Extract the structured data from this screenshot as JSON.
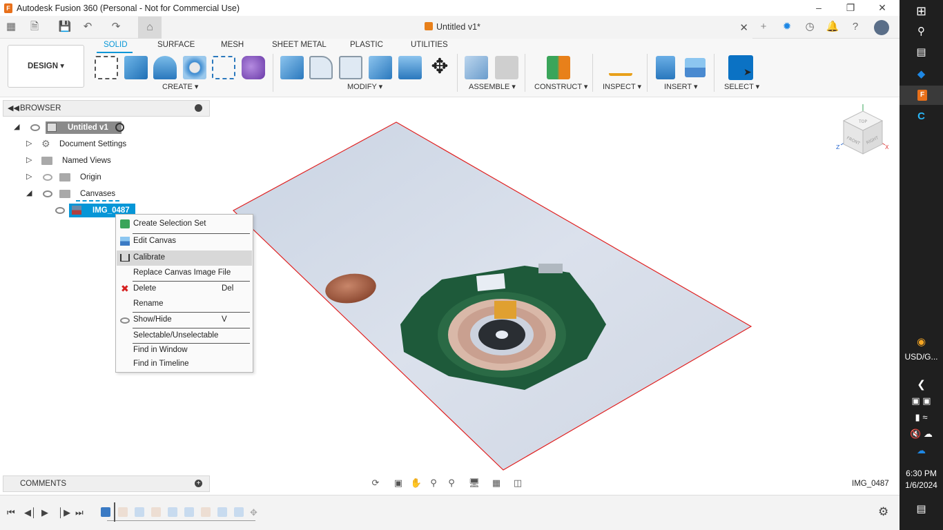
{
  "window": {
    "title": "Autodesk Fusion 360 (Personal - Not for Commercial Use)",
    "app_icon": "F"
  },
  "document": {
    "title": "Untitled v1*"
  },
  "ribbon": {
    "workspace": "DESIGN",
    "tabs": [
      "SOLID",
      "SURFACE",
      "MESH",
      "SHEET METAL",
      "PLASTIC",
      "UTILITIES"
    ],
    "active_tab": "SOLID",
    "groups": [
      "CREATE",
      "MODIFY",
      "ASSEMBLE",
      "CONSTRUCT",
      "INSPECT",
      "INSERT",
      "SELECT"
    ]
  },
  "browser": {
    "title": "BROWSER",
    "root": "Untitled v1",
    "items": [
      "Document Settings",
      "Named Views",
      "Origin",
      "Canvases"
    ],
    "canvas": "IMG_0487"
  },
  "context_menu": {
    "items": [
      {
        "label": "Create Selection Set",
        "shortcut": ""
      },
      {
        "label": "Edit Canvas",
        "shortcut": ""
      },
      {
        "label": "Calibrate",
        "shortcut": ""
      },
      {
        "label": "Replace Canvas Image File",
        "shortcut": ""
      },
      {
        "label": "Delete",
        "shortcut": "Del"
      },
      {
        "label": "Rename",
        "shortcut": ""
      },
      {
        "label": "Show/Hide",
        "shortcut": "V"
      },
      {
        "label": "Selectable/Unselectable",
        "shortcut": ""
      },
      {
        "label": "Find in Window",
        "shortcut": ""
      },
      {
        "label": "Find in Timeline",
        "shortcut": ""
      }
    ],
    "highlighted": "Calibrate"
  },
  "viewcube": {
    "top": "TOP",
    "front": "FRONT",
    "right": "RIGHT",
    "x": "X",
    "z": "Z"
  },
  "comments": {
    "title": "COMMENTS"
  },
  "status": {
    "selection_name": "IMG_0487"
  },
  "taskbar": {
    "time": "6:30 PM",
    "date": "1/6/2024",
    "currency": "USD/G..."
  },
  "colors": {
    "accent": "#0696d7",
    "canvas_border": "#e02020",
    "pcb_green": "#1e5a3a",
    "menu_highlight": "#d8d8d8"
  }
}
